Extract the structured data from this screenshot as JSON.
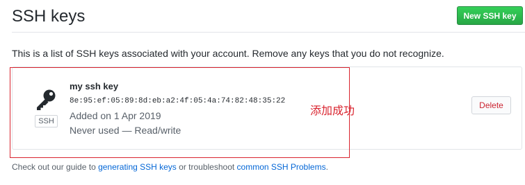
{
  "header": {
    "title": "SSH keys",
    "new_key_button": "New SSH key"
  },
  "intro_text": "This is a list of SSH keys associated with your account. Remove any keys that you do not recognize.",
  "keys": [
    {
      "name": "my ssh key",
      "fingerprint": "8e:95:ef:05:89:8d:eb:a2:4f:05:4a:74:82:48:35:22",
      "added": "Added on 1 Apr 2019",
      "usage": "Never used — Read/write",
      "badge": "SSH",
      "icon": "key-icon",
      "delete_label": "Delete"
    }
  ],
  "annotation": {
    "text": "添加成功",
    "color": "#d9232e"
  },
  "footer": {
    "prefix": "Check out our guide to ",
    "link1": "generating SSH keys",
    "middle": " or troubleshoot ",
    "link2": "common SSH Problems",
    "suffix": "."
  },
  "colors": {
    "primary_button": "#2ea44f",
    "danger_text": "#cb2431",
    "link": "#0366d6"
  }
}
